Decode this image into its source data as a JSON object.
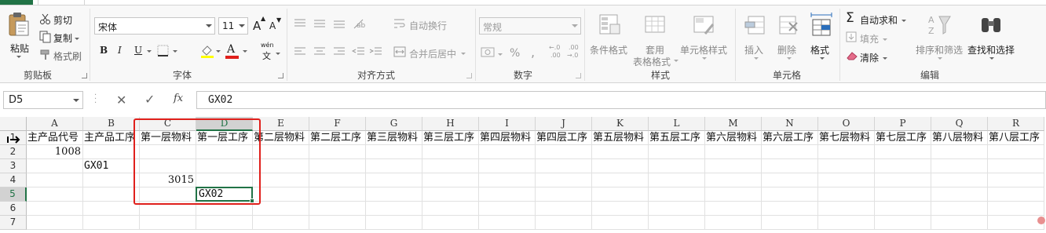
{
  "ribbon": {
    "clipboard": {
      "paste_label": "粘贴",
      "cut_label": "剪切",
      "copy_label": "复制",
      "format_painter_label": "格式刷",
      "group_label": "剪贴板"
    },
    "font": {
      "font_name": "宋体",
      "font_size": "11",
      "grow_label": "A",
      "shrink_label": "A",
      "bold_label": "B",
      "italic_label": "I",
      "underline_label": "U",
      "font_color_label": "A",
      "phonetic_label": "wén",
      "phonetic_char": "文",
      "group_label": "字体"
    },
    "alignment": {
      "wrap_label": "自动换行",
      "merge_label": "合并后居中",
      "group_label": "对齐方式"
    },
    "number": {
      "format_value": "常规",
      "percent_label": "%",
      "comma_label": ",",
      "inc_decimal_top": "←.0",
      "inc_decimal_bottom": ".00",
      "dec_decimal_top": ".00",
      "dec_decimal_bottom": "→.0",
      "group_label": "数字"
    },
    "styles": {
      "conditional_label": "条件格式",
      "table_label_1": "套用",
      "table_label_2": "表格格式",
      "cell_styles_label": "单元格样式",
      "group_label": "样式"
    },
    "cells": {
      "insert_label": "插入",
      "delete_label": "删除",
      "format_label": "格式",
      "group_label": "单元格"
    },
    "editing": {
      "autosum_label": "自动求和",
      "fill_label": "填充",
      "clear_label": "清除",
      "sort_label": "排序和筛选",
      "find_label": "查找和选择",
      "group_label": "编辑"
    }
  },
  "formula_bar": {
    "name_box": "D5",
    "fx_label": "fx",
    "content": "GX02"
  },
  "grid": {
    "columns": [
      "A",
      "B",
      "C",
      "D",
      "E",
      "F",
      "G",
      "H",
      "I",
      "J",
      "K",
      "L",
      "M",
      "N",
      "O",
      "P",
      "Q",
      "R"
    ],
    "rows": [
      "1",
      "2",
      "3",
      "4",
      "5",
      "6",
      "7"
    ],
    "header_row": [
      "主产品代号",
      "主产品工序",
      "第一层物料",
      "第一层工序",
      "第二层物料",
      "第二层工序",
      "第三层物料",
      "第三层工序",
      "第四层物料",
      "第四层工序",
      "第五层物料",
      "第五层工序",
      "第六层物料",
      "第六层工序",
      "第七层物料",
      "第七层工序",
      "第八层物料",
      "第八层工序"
    ],
    "a2": "1008",
    "b3": "GX01",
    "c4": "3015",
    "d5": "GX02",
    "selected_column": "D",
    "selected_row": "5"
  },
  "colors": {
    "accent": "#217346",
    "highlight": "#e0201c"
  }
}
